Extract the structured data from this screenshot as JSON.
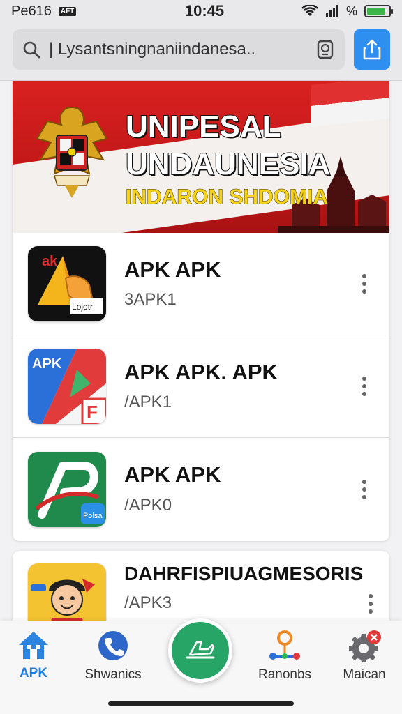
{
  "status_bar": {
    "carrier": "Pe616",
    "badge": "AFT",
    "time": "10:45",
    "percent_symbol": "%",
    "battery_level": 0.85,
    "battery_color": "#3bb54a"
  },
  "search": {
    "value": "| Lysantsningnaniindanesa..",
    "icon_left": "search-icon",
    "icon_right": "lens-icon"
  },
  "share_button": {
    "icon": "share-upload-icon",
    "color": "#2f8ff0"
  },
  "banner": {
    "title_line1": "UNIPESAL",
    "title_line2": "UNDAUNESIA",
    "title_line3": "INDARON SHDOMIA",
    "emblem": "garuda-emblem-icon",
    "red": "#d92121",
    "yellow": "#f5d21a"
  },
  "apps": [
    {
      "title": "APK APK",
      "subtitle": "3APK1",
      "icon_label_top": "ak",
      "icon_label_bottom": "Lojotr"
    },
    {
      "title": "APK APK. APK",
      "subtitle": "/APK1",
      "icon_label_top": "APK",
      "icon_label_bottom": "F"
    },
    {
      "title": "APK APK",
      "subtitle": "/APK0",
      "icon_label_badge": "Polsa"
    },
    {
      "title": "DAHRFISPIUAGMESORIS",
      "subtitle": "/APK3"
    }
  ],
  "bottom_nav": {
    "items": [
      {
        "label": "APK",
        "icon": "home-icon",
        "active": true
      },
      {
        "label": "Shwanics",
        "icon": "phone-icon",
        "active": false
      },
      {
        "label": "Ranonbs",
        "icon": "route-icon",
        "active": false
      },
      {
        "label": "Maican",
        "icon": "gear-badge-icon",
        "active": false
      }
    ],
    "fab_icon": "plane-icon",
    "fab_color": "#27a567",
    "active_color": "#1f7fe0"
  }
}
